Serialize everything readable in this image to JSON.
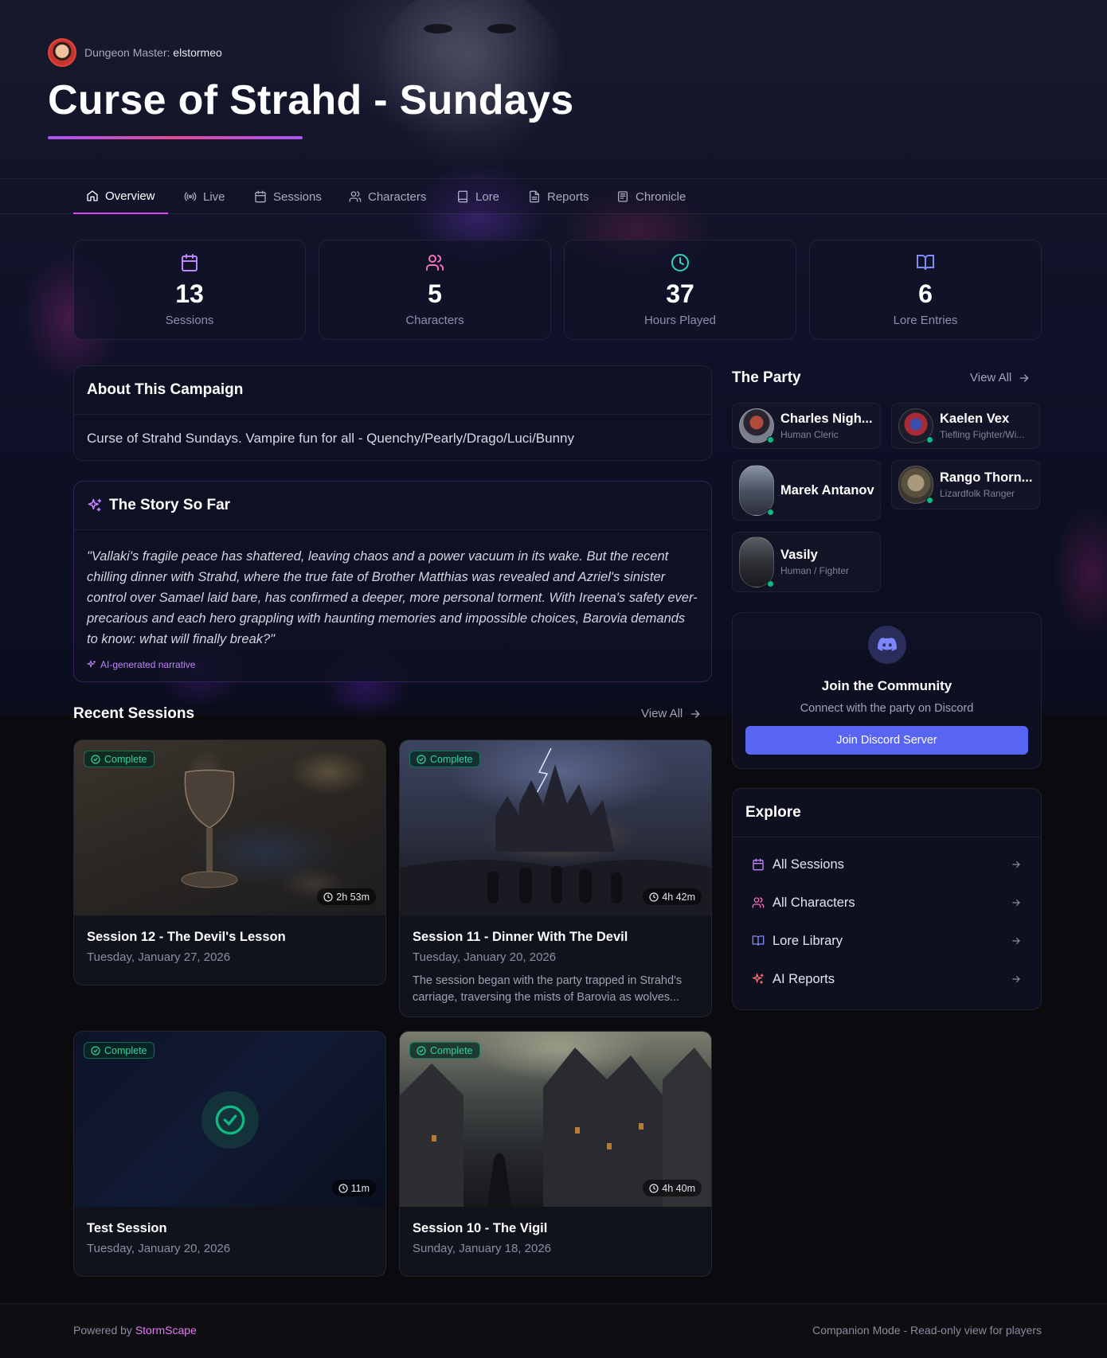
{
  "header": {
    "dm_label": "Dungeon Master:",
    "dm_name": "elstormeo",
    "title": "Curse of Strahd - Sundays"
  },
  "tabs": [
    {
      "label": "Overview",
      "icon": "home-icon",
      "active": true
    },
    {
      "label": "Live",
      "icon": "broadcast-icon"
    },
    {
      "label": "Sessions",
      "icon": "calendar-icon"
    },
    {
      "label": "Characters",
      "icon": "users-icon"
    },
    {
      "label": "Lore",
      "icon": "book-icon"
    },
    {
      "label": "Reports",
      "icon": "file-text-icon"
    },
    {
      "label": "Chronicle",
      "icon": "newspaper-icon"
    }
  ],
  "stats": [
    {
      "value": "13",
      "label": "Sessions",
      "icon": "calendar-icon",
      "color": "#c084fc"
    },
    {
      "value": "5",
      "label": "Characters",
      "icon": "users-icon",
      "color": "#f472b6"
    },
    {
      "value": "37",
      "label": "Hours Played",
      "icon": "clock-icon",
      "color": "#2dd4bf"
    },
    {
      "value": "6",
      "label": "Lore Entries",
      "icon": "book-open-icon",
      "color": "#818cf8"
    }
  ],
  "about": {
    "title": "About This Campaign",
    "text": "Curse of Strahd Sundays. Vampire fun for all - Quenchy/Pearly/Drago/Luci/Bunny"
  },
  "story": {
    "title": "The Story So Far",
    "text": "\"Vallaki's fragile peace has shattered, leaving chaos and a power vacuum in its wake. But the recent chilling dinner with Strahd, where the true fate of Brother Matthias was revealed and Azriel's sinister control over Samael laid bare, has confirmed a deeper, more personal torment. With Ireena's safety ever-precarious and each hero grappling with haunting memories and impossible choices, Barovia demands to know: what will finally break?\"",
    "note": "AI-generated narrative"
  },
  "recent_sessions": {
    "title": "Recent Sessions",
    "view_all": "View All",
    "items": [
      {
        "badge": "Complete",
        "duration": "2h 53m",
        "title": "Session 12 - The Devil's Lesson",
        "date": "Tuesday, January 27, 2026",
        "desc": ""
      },
      {
        "badge": "Complete",
        "duration": "4h 42m",
        "title": "Session 11 - Dinner With The Devil",
        "date": "Tuesday, January 20, 2026",
        "desc": "The session began with the party trapped in Strahd's carriage, traversing the mists of Barovia as wolves..."
      },
      {
        "badge": "Complete",
        "duration": "11m",
        "title": "Test Session",
        "date": "Tuesday, January 20, 2026",
        "desc": ""
      },
      {
        "badge": "Complete",
        "duration": "4h 40m",
        "title": "Session 10 - The Vigil",
        "date": "Sunday, January 18, 2026",
        "desc": ""
      }
    ]
  },
  "party": {
    "title": "The Party",
    "view_all": "View All",
    "members": [
      {
        "name": "Charles Nigh...",
        "class": "Human Cleric"
      },
      {
        "name": "Kaelen Vex",
        "class": "Tiefling Fighter/Wi..."
      },
      {
        "name": "Marek Antanov",
        "class": ""
      },
      {
        "name": "Rango Thorn...",
        "class": "Lizardfolk Ranger"
      },
      {
        "name": "Vasily",
        "class": "Human / Fighter"
      }
    ]
  },
  "community": {
    "title": "Join the Community",
    "subtitle": "Connect with the party on Discord",
    "button": "Join Discord Server",
    "icon": "discord-icon",
    "button_color": "#5865f2"
  },
  "explore": {
    "title": "Explore",
    "items": [
      {
        "label": "All Sessions",
        "icon": "calendar-icon"
      },
      {
        "label": "All Characters",
        "icon": "users-icon"
      },
      {
        "label": "Lore Library",
        "icon": "book-open-icon"
      },
      {
        "label": "AI Reports",
        "icon": "sparkles-icon"
      }
    ]
  },
  "footer": {
    "powered_by": "Powered by",
    "brand": "StormScape",
    "mode": "Companion Mode - Read-only view for players"
  },
  "colors": {
    "accent": "#d946ef",
    "complete": "#34d399",
    "online": "#10b981"
  }
}
